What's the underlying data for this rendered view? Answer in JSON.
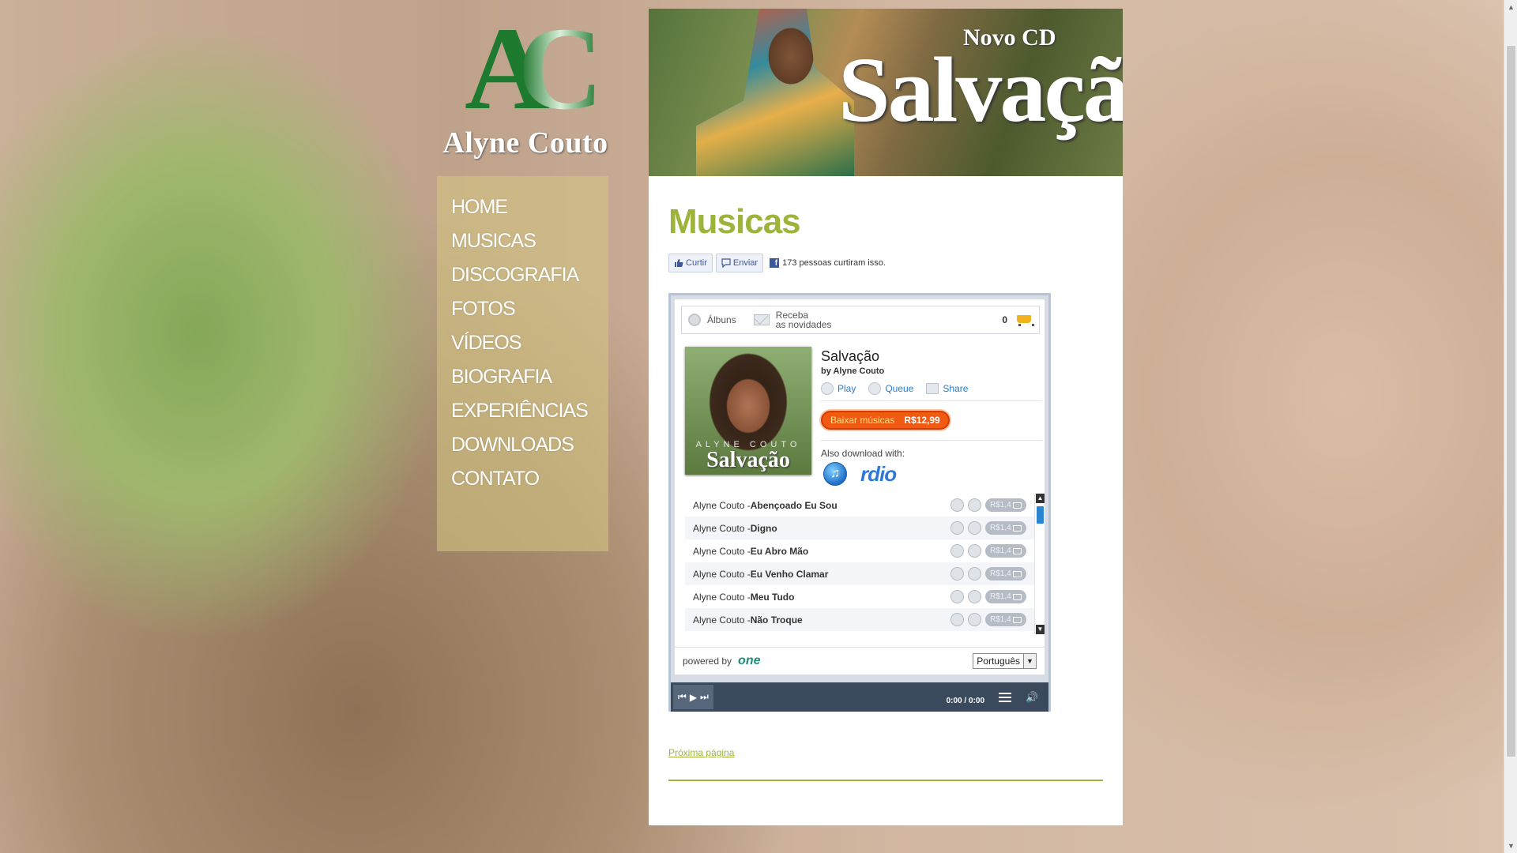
{
  "logo": {
    "mark_a": "A",
    "mark_c": "C",
    "name": "Alyne Couto"
  },
  "nav": {
    "items": [
      "HOME",
      "MUSICAS",
      "DISCOGRAFIA",
      "FOTOS",
      "VÍDEOS",
      "BIOGRAFIA",
      "EXPERIÊNCIAS",
      "DOWNLOADS",
      "CONTATO"
    ]
  },
  "banner": {
    "subtitle": "Novo CD",
    "title": "Salvação"
  },
  "page": {
    "title": "Musicas",
    "next_link": "Próxima página"
  },
  "social": {
    "like_label": "Curtir",
    "send_label": "Enviar",
    "like_count_text": "173 pessoas curtiram isso."
  },
  "widget": {
    "tabs": {
      "albums": "Álbuns",
      "news_line1": "Receba",
      "news_line2": "as novidades",
      "cart_count": "0"
    },
    "album": {
      "cover_artist": "ALYNE COUTO",
      "cover_title": "Salvação",
      "title": "Salvação",
      "by": "by Alyne Couto",
      "actions": {
        "play": "Play",
        "queue": "Queue",
        "share": "Share"
      },
      "buy_label": "Baixar músicas",
      "buy_price": "R$12,99",
      "also_download": "Also download with:",
      "rdio": "rdio"
    },
    "tracks": [
      {
        "artist": "Alyne Couto - ",
        "title": "Abençoado Eu Sou",
        "price": "R$1,4"
      },
      {
        "artist": "Alyne Couto - ",
        "title": "Digno",
        "price": "R$1,4"
      },
      {
        "artist": "Alyne Couto - ",
        "title": "Eu Abro Mão",
        "price": "R$1,4"
      },
      {
        "artist": "Alyne Couto - ",
        "title": "Eu Venho Clamar",
        "price": "R$1,4"
      },
      {
        "artist": "Alyne Couto - ",
        "title": "Meu Tudo",
        "price": "R$1,4"
      },
      {
        "artist": "Alyne Couto - ",
        "title": "Não Troque",
        "price": "R$1,4"
      }
    ],
    "footer": {
      "powered_by": "powered by",
      "brand": "one",
      "language": "Português"
    },
    "player": {
      "time_current": "0:00",
      "time_separator": "/",
      "time_total": "0:00"
    }
  },
  "colors": {
    "accent_green": "#9db43b",
    "buy_orange": "#f05a12",
    "link_blue": "#2d7cc7"
  }
}
